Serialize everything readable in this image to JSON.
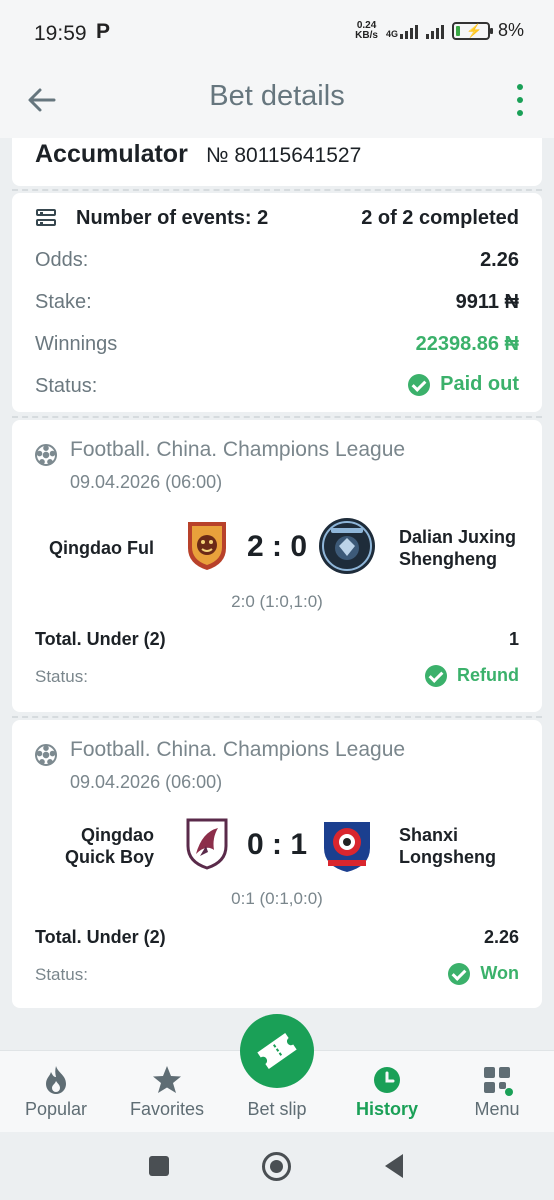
{
  "status_bar": {
    "time": "19:59",
    "app_indicator": "P",
    "net_speed_value": "0.24",
    "net_speed_unit": "KB/s",
    "network": "4G",
    "battery": "8%"
  },
  "header": {
    "title": "Bet details",
    "back_icon": "arrow-left-icon",
    "more_icon": "more-vertical-icon"
  },
  "bet": {
    "type": "Accumulator",
    "number": "№ 80115641527"
  },
  "summary": {
    "events_label": "Number of events: 2",
    "completed": "2 of 2 completed",
    "odds_label": "Odds:",
    "odds_value": "2.26",
    "stake_label": "Stake:",
    "stake_value": "9911 ₦",
    "winnings_label": "Winnings",
    "winnings_value": "22398.86 ₦",
    "status_label": "Status:",
    "status_value": "Paid out",
    "accent_color": "#3bb16b"
  },
  "events": [
    {
      "league": "Football. China. Champions League",
      "date": "09.04.2026 (06:00)",
      "home": "Qingdao Ful",
      "away_line1": "Dalian Juxing",
      "away_line2": "Shengheng",
      "score": "2 : 0",
      "final": "2:0 (1:0,1:0)",
      "market": "Total. Under (2)",
      "odds": "1",
      "status_label": "Status:",
      "status": "Refund"
    },
    {
      "league": "Football. China. Champions League",
      "date": "09.04.2026 (06:00)",
      "home_line1": "Qingdao",
      "home_line2": "Quick Boy",
      "away_line1": "Shanxi",
      "away_line2": "Longsheng",
      "score": "0 : 1",
      "final": "0:1 (0:1,0:0)",
      "market": "Total. Under (2)",
      "odds": "2.26",
      "status_label": "Status:",
      "status": "Won"
    }
  ],
  "bottom_nav": {
    "items": [
      {
        "label": "Popular",
        "icon": "flame-icon"
      },
      {
        "label": "Favorites",
        "icon": "star-icon"
      },
      {
        "label": "Bet slip",
        "icon": "ticket-icon"
      },
      {
        "label": "History",
        "icon": "clock-icon",
        "active": true
      },
      {
        "label": "Menu",
        "icon": "grid-icon"
      }
    ],
    "active_color": "#1aa057"
  }
}
